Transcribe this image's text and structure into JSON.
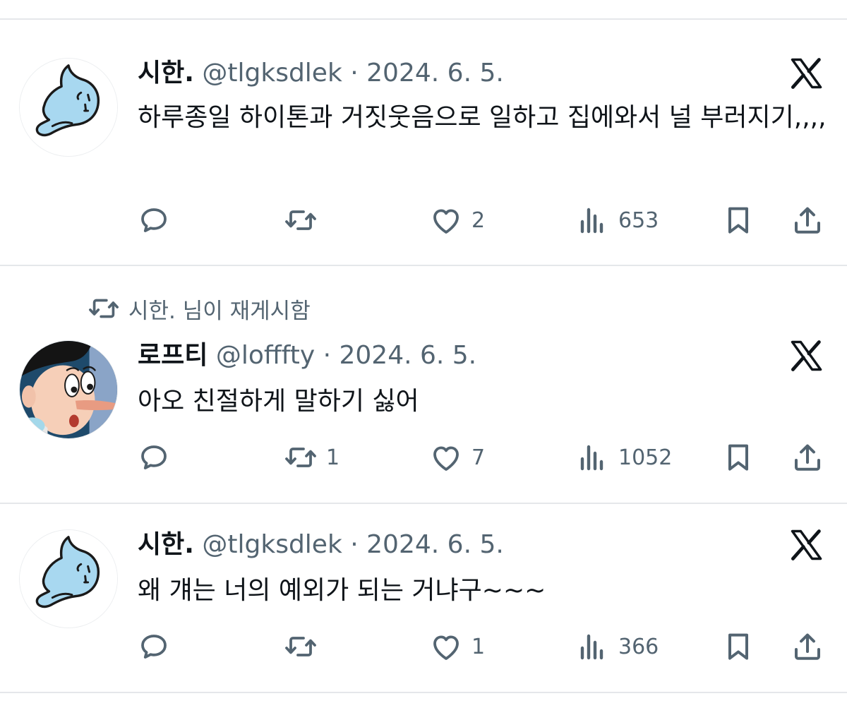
{
  "tweets": [
    {
      "name": "시한.",
      "handle": "@tlgksdlek",
      "separator": "·",
      "date": "2024. 6. 5.",
      "text": "하루종일 하이톤과 거짓웃음으로 일하고 집에와서 널 부러지기,,,,",
      "counts": {
        "reply": "",
        "retweet": "",
        "like": "2",
        "views": "653"
      },
      "avatar": "blue-cartoon-ghost"
    },
    {
      "retweet_note": "시한. 님이 재게시함",
      "name": "로프티",
      "handle": "@lofffty",
      "separator": "·",
      "date": "2024. 6. 5.",
      "text": "아오 친절하게 말하기 싫어",
      "counts": {
        "reply": "",
        "retweet": "1",
        "like": "7",
        "views": "1052"
      },
      "avatar": "pinocchio-cartoon"
    },
    {
      "name": "시한.",
      "handle": "@tlgksdlek",
      "separator": "·",
      "date": "2024. 6. 5.",
      "text": "왜 걔는 너의 예외가 되는 거냐구~~~",
      "counts": {
        "reply": "",
        "retweet": "",
        "like": "1",
        "views": "366"
      },
      "avatar": "blue-cartoon-ghost"
    }
  ],
  "icons": {
    "reply": "speech-bubble-icon",
    "retweet": "retweet-arrows-icon",
    "like": "heart-icon",
    "views": "bar-chart-icon",
    "bookmark": "bookmark-icon",
    "share": "share-upload-icon",
    "platform": "x-logo-icon"
  },
  "colors": {
    "text": "#0f1419",
    "muted": "#536471",
    "divider": "#e5e7ea",
    "avatar_blue": "#a8d8f0"
  }
}
